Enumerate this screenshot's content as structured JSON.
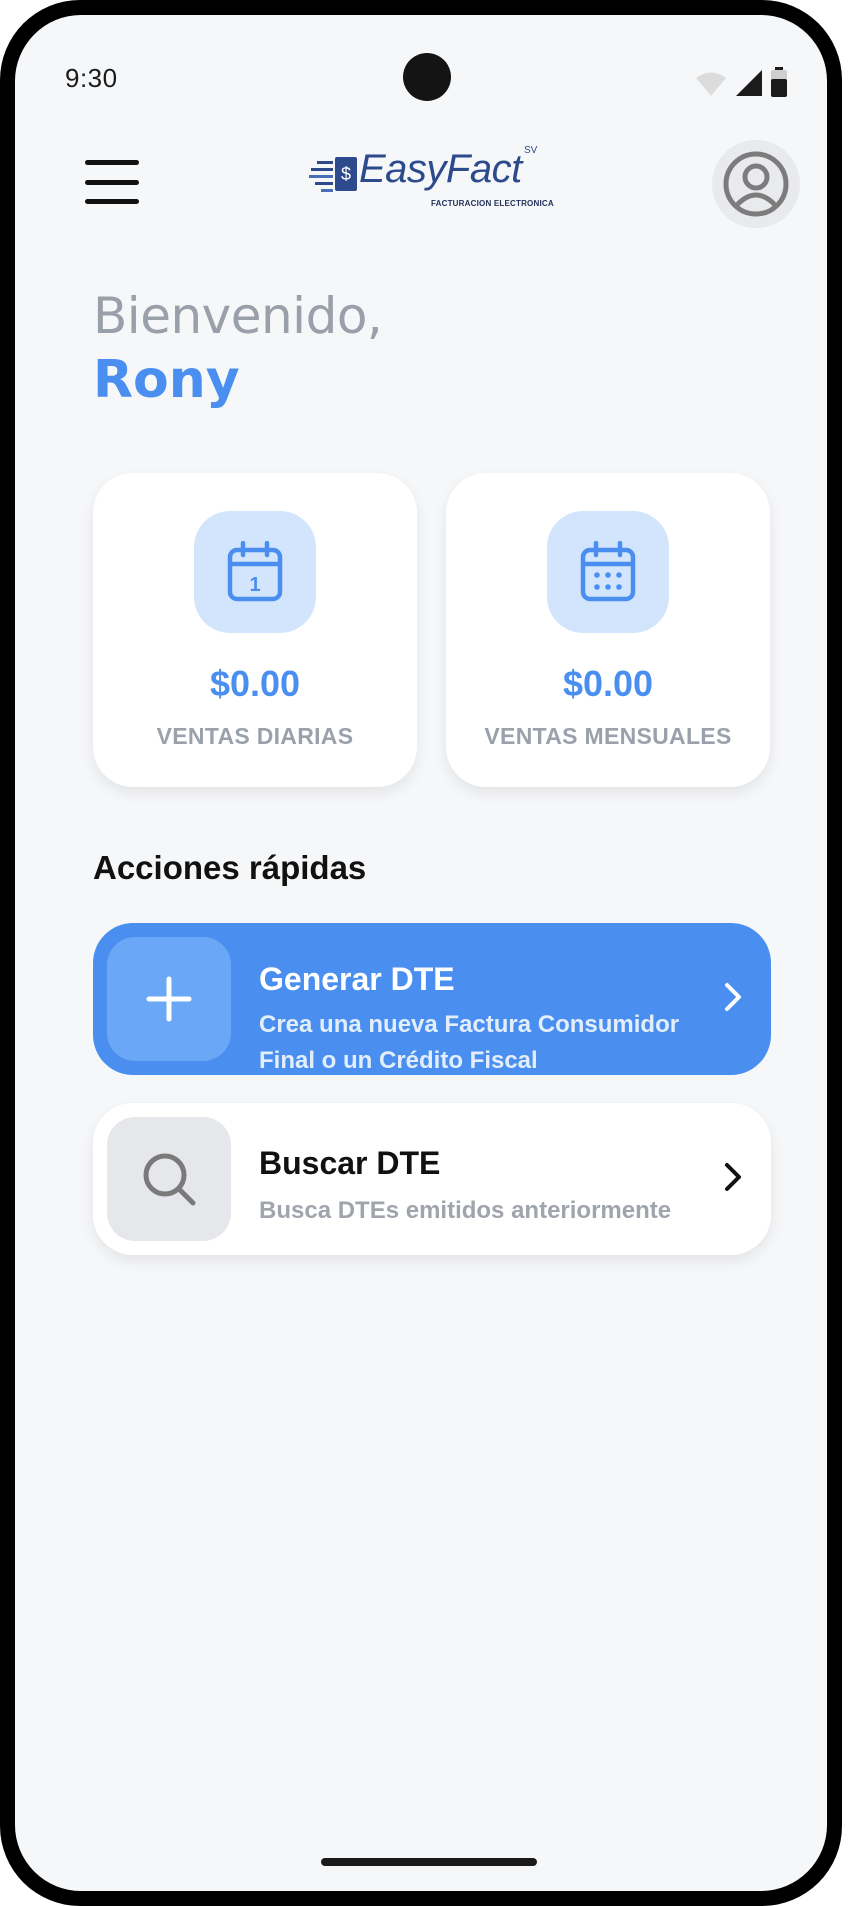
{
  "status_bar": {
    "time": "9:30"
  },
  "header": {
    "logo_word": "EasyFact",
    "logo_suffix": "SV",
    "logo_subtitle": "FACTURACION ELECTRONICA",
    "logo_color": "#2c4a8c"
  },
  "greeting": {
    "welcome": "Bienvenido,",
    "name": "Rony"
  },
  "stats": [
    {
      "value": "$0.00",
      "label": "VENTAS DIARIAS",
      "icon": "calendar-day-icon",
      "day": "1"
    },
    {
      "value": "$0.00",
      "label": "VENTAS MENSUALES",
      "icon": "calendar-month-icon"
    }
  ],
  "quick_actions": {
    "title": "Acciones rápidas",
    "items": [
      {
        "title": "Generar DTE",
        "description": "Crea una nueva Factura Consumidor Final o un Crédito Fiscal",
        "icon": "plus-icon"
      },
      {
        "title": "Buscar DTE",
        "description": "Busca DTEs emitidos anteriormente",
        "icon": "search-icon"
      }
    ]
  },
  "colors": {
    "accent": "#4a8ff0",
    "accent_light": "#d3e5fc",
    "background": "#f6f7f9",
    "muted_text": "#9ba1ab"
  }
}
